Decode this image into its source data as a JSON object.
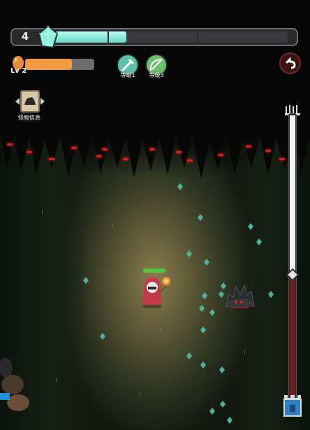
{
  "hud": {
    "player_level": "4",
    "xp_progress": 0.34,
    "egg_progress": 0.68,
    "lv_label": "Lv 2",
    "accent_color": "#67d6c4"
  },
  "skills": [
    {
      "name": "sword-skill-icon",
      "label": "等级1",
      "color": "#5fbfa6"
    },
    {
      "name": "bow-skill-icon",
      "label": "等级3",
      "color": "#6fc06a"
    }
  ],
  "monster_info": {
    "label": "怪物信息"
  },
  "stage_progress": 0.54
}
